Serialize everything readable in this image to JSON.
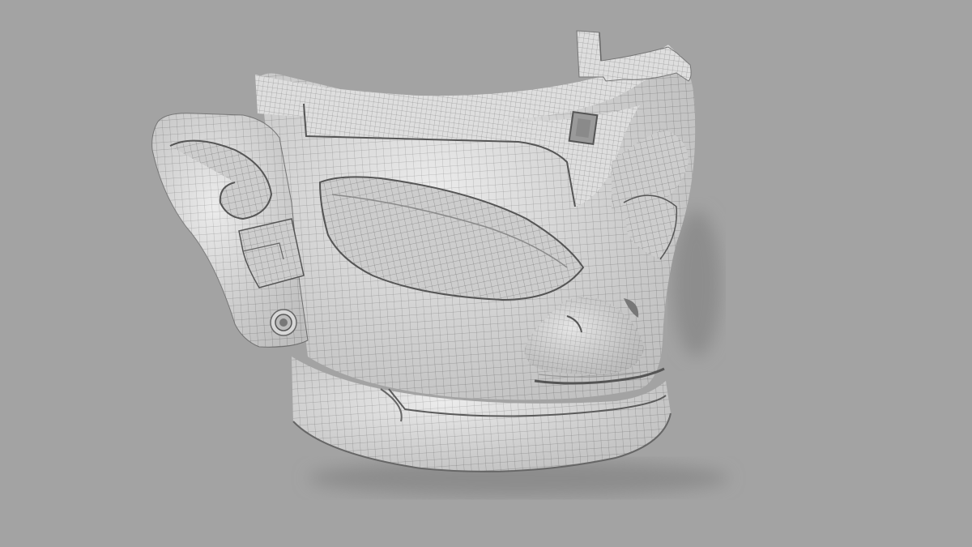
{
  "scene": {
    "subject": "wireframe-mask-render",
    "colors": {
      "background": "#a3a3a3",
      "surface": "#e8e8e8",
      "surface_dark": "#cfcfcf",
      "shadow": "#8f8f8f",
      "wire": "#6e6e6e",
      "crease": "#555555"
    },
    "grid_visible": true
  }
}
